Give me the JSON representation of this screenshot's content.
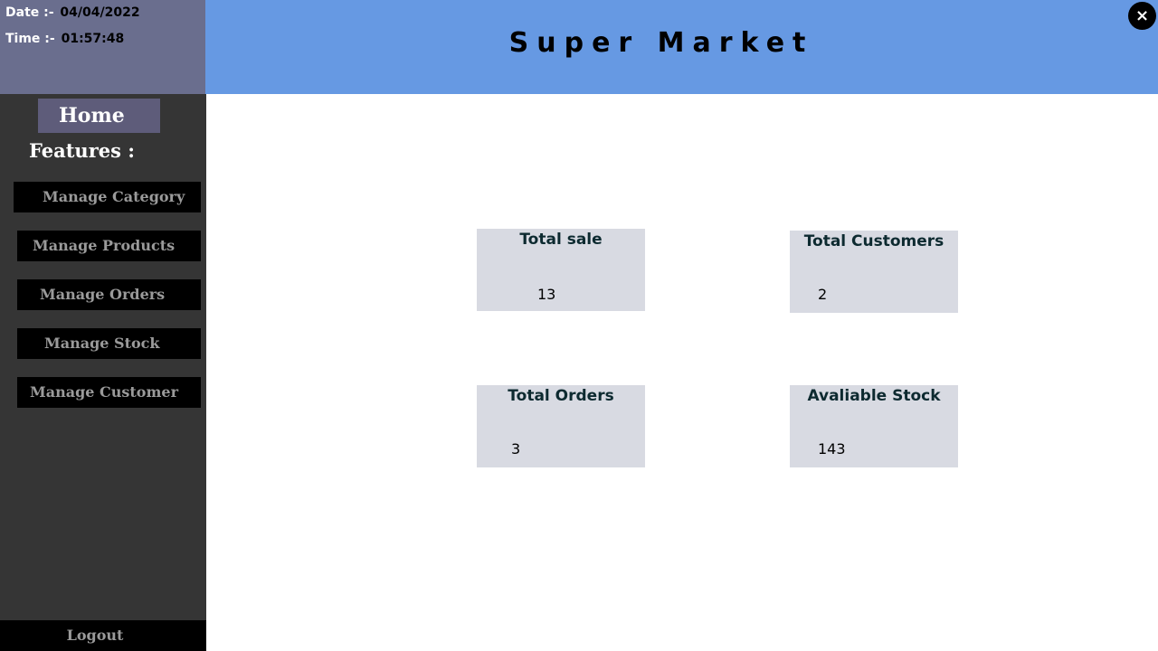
{
  "datetime": {
    "date_label": "Date :-",
    "date_value": "04/04/2022",
    "time_label": "Time :-",
    "time_value": "01:57:48"
  },
  "header": {
    "title": "Super Market",
    "close_icon": "×"
  },
  "sidebar": {
    "home_label": "Home",
    "features_label": "Features :",
    "items": [
      {
        "label": "Manage Category"
      },
      {
        "label": "Manage Products"
      },
      {
        "label": "Manage Orders"
      },
      {
        "label": "Manage Stock"
      },
      {
        "label": "Manage Customer"
      }
    ],
    "logout_label": "Logout"
  },
  "stats": [
    {
      "title": "Total sale",
      "value": "13"
    },
    {
      "title": "Total Customers",
      "value": "2"
    },
    {
      "title": "Total Orders",
      "value": "3"
    },
    {
      "title": "Avaliable Stock",
      "value": "143"
    }
  ],
  "colors": {
    "header_bg": "#6699e3",
    "sidebar_bg": "#353535",
    "datetime_bg": "#6a6e8e",
    "home_bg": "#5e5c7a",
    "card_bg": "#d8dae2"
  }
}
